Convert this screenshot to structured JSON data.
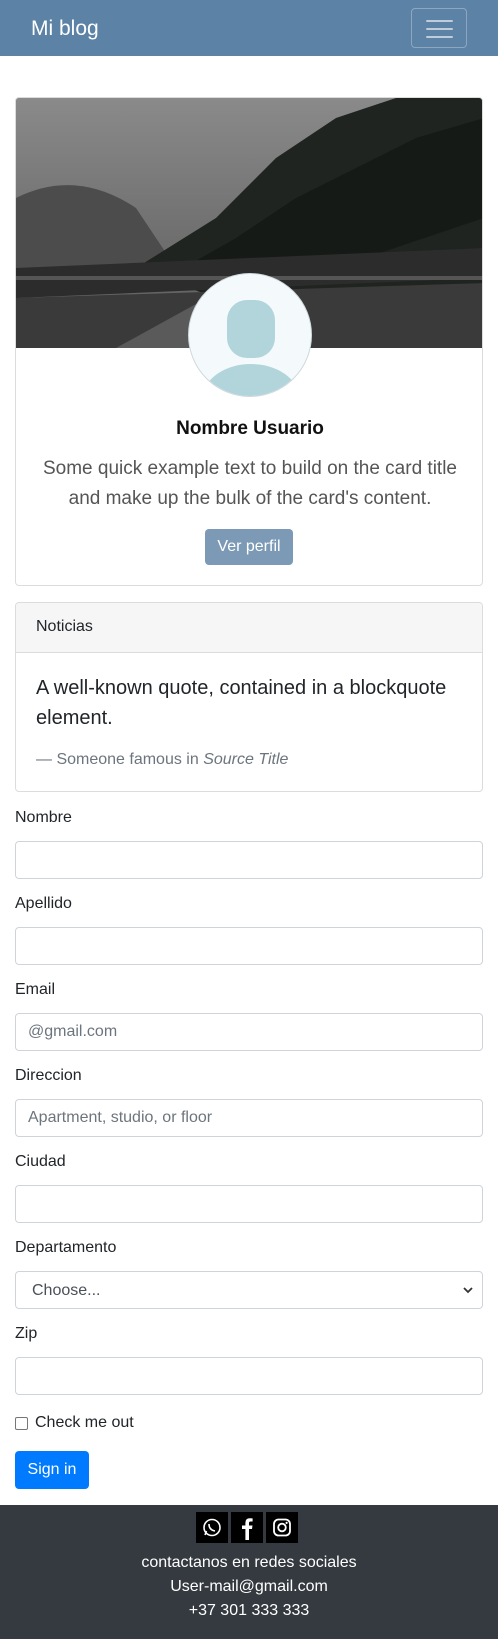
{
  "navbar": {
    "brand": "Mi blog"
  },
  "profile": {
    "name": "Nombre Usuario",
    "text": "Some quick example text to build on the card title and make up the bulk of the card's content.",
    "button_label": "Ver perfil"
  },
  "news": {
    "header": "Noticias",
    "quote": "A well-known quote, contained in a blockquote element.",
    "footer_prefix": "— Someone famous in ",
    "source_title": "Source Title"
  },
  "form": {
    "nombre_label": "Nombre",
    "apellido_label": "Apellido",
    "email_label": "Email",
    "email_placeholder": "@gmail.com",
    "direccion_label": "Direccion",
    "direccion_placeholder": "Apartment, studio, or floor",
    "ciudad_label": "Ciudad",
    "departamento_label": "Departamento",
    "departamento_selected": "Choose...",
    "zip_label": "Zip",
    "check_label": "Check me out",
    "submit_label": "Sign in"
  },
  "footer": {
    "icons": [
      "whatsapp-icon",
      "facebook-icon",
      "instagram-icon"
    ],
    "contact_text": "contactanos en redes sociales",
    "email": "User-mail@gmail.com",
    "phone": "+37 301 333 333"
  },
  "colors": {
    "navbar": "#5c82a5",
    "profile_button": "#7c9ab5",
    "primary_button": "#007bff",
    "footer": "#343a40"
  }
}
